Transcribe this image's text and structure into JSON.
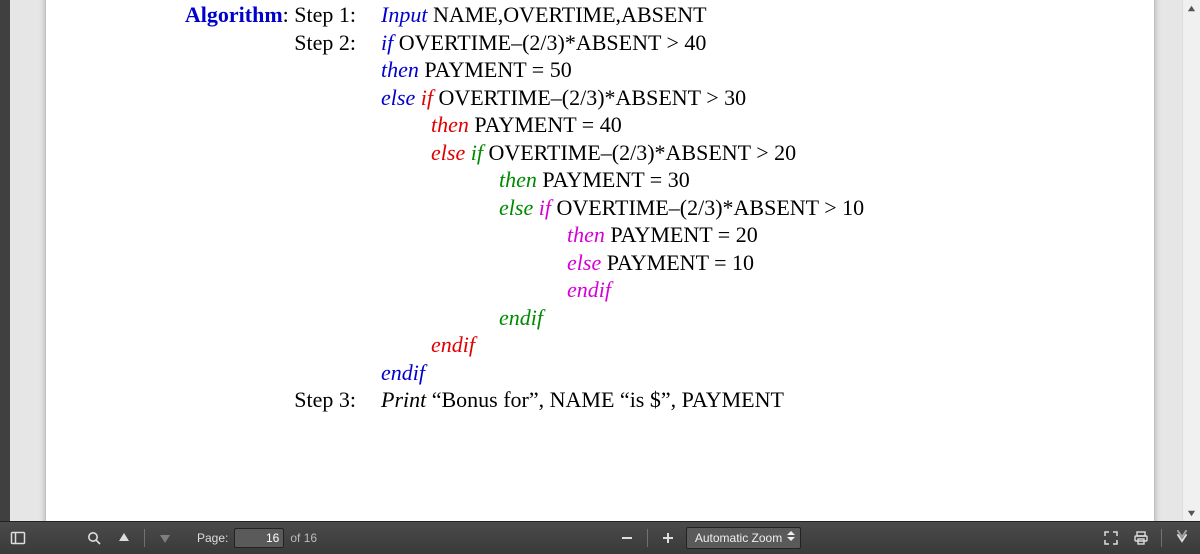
{
  "colors": {
    "blue": "#0000cc",
    "red": "#e00000",
    "green": "#008a00",
    "magenta": "#d600d6"
  },
  "doc": {
    "algo_label": "Algorithm",
    "step1_label": ": Step 1:",
    "step2_label": "Step 2:",
    "step3_label": "Step 3:",
    "kw_input": "Input",
    "kw_if": "if",
    "kw_then": "then",
    "kw_else": "else",
    "kw_endif": "endif",
    "kw_print": "Print",
    "input_vars": " NAME,OVERTIME,ABSENT",
    "cond40": " OVERTIME–(2/3)*ABSENT > 40",
    "pay50": " PAYMENT = 50",
    "cond30": " OVERTIME–(2/3)*ABSENT > 30",
    "pay40": " PAYMENT = 40",
    "cond20": " OVERTIME–(2/3)*ABSENT > 20",
    "pay30": " PAYMENT = 30",
    "cond10": " OVERTIME–(2/3)*ABSENT > 10",
    "pay20": " PAYMENT = 20",
    "pay10": " PAYMENT = 10",
    "print_line": " “Bonus for”, NAME “is $”, PAYMENT",
    "else_sp": "else   "
  },
  "toolbar": {
    "page_label": "Page:",
    "page_current": "16",
    "page_total": "of 16",
    "zoom_label": "Automatic Zoom"
  }
}
